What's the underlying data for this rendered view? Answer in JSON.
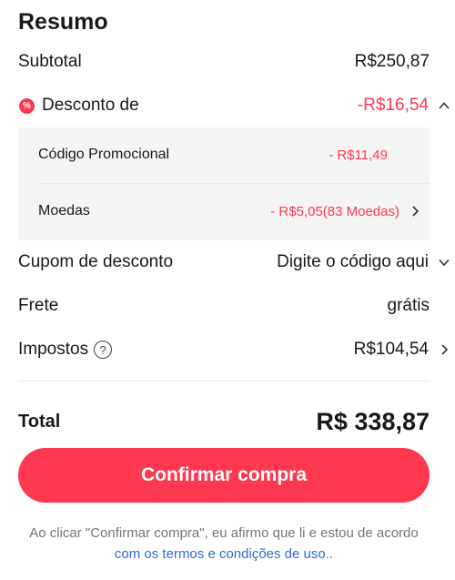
{
  "summary": {
    "title": "Resumo",
    "subtotal": {
      "label": "Subtotal",
      "value": "R$250,87"
    },
    "discount": {
      "badge": "%",
      "label": "Desconto de",
      "value": "-R$16,54",
      "items": [
        {
          "label": "Código Promocional",
          "value": "- R$11,49"
        },
        {
          "label": "Moedas",
          "value": "- R$5,05(83 Moedas)"
        }
      ]
    },
    "coupon": {
      "label": "Cupom de desconto",
      "value": "Digite o código aqui"
    },
    "shipping": {
      "label": "Frete",
      "value": "grátis"
    },
    "taxes": {
      "label": "Impostos",
      "help": "?",
      "value": "R$104,54"
    },
    "total": {
      "label": "Total",
      "value": "R$ 338,87"
    },
    "confirm_label": "Confirmar compra",
    "terms_prefix": "Ao clicar \"Confirmar compra\", eu afirmo que li e estou de acordo ",
    "terms_link": "com os termos e condições de uso",
    "terms_suffix": ".."
  },
  "colors": {
    "accent": "#fd384f",
    "link": "#2e6bd0",
    "panel": "#f5f5f5"
  }
}
